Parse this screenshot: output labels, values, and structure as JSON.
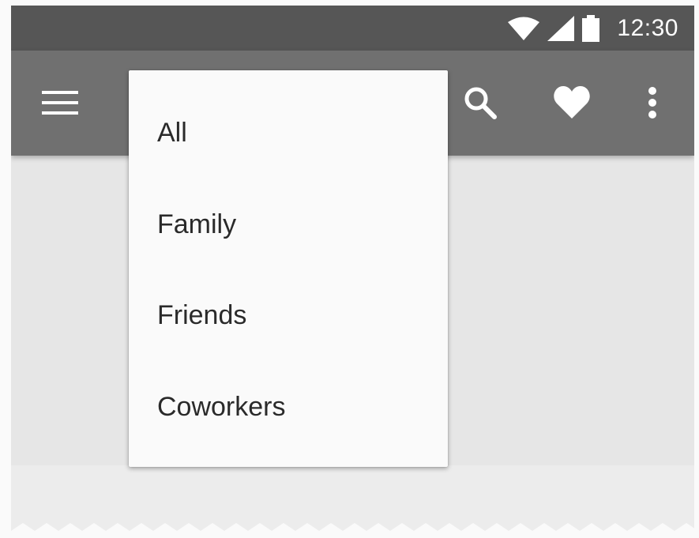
{
  "status_bar": {
    "time": "12:30",
    "icons": [
      "wifi-icon",
      "cellular-signal-icon",
      "battery-icon"
    ]
  },
  "app_bar": {
    "actions": [
      "menu-icon",
      "search-icon",
      "heart-icon",
      "more-vert-icon"
    ]
  },
  "dropdown": {
    "items": [
      {
        "label": "All"
      },
      {
        "label": "Family"
      },
      {
        "label": "Friends"
      },
      {
        "label": "Coworkers"
      }
    ]
  },
  "colors": {
    "status_bar": "#565656",
    "app_bar": "#707070",
    "menu_surface": "#fafafa",
    "content_background": "#e6e6e6",
    "icon": "#ffffff"
  }
}
